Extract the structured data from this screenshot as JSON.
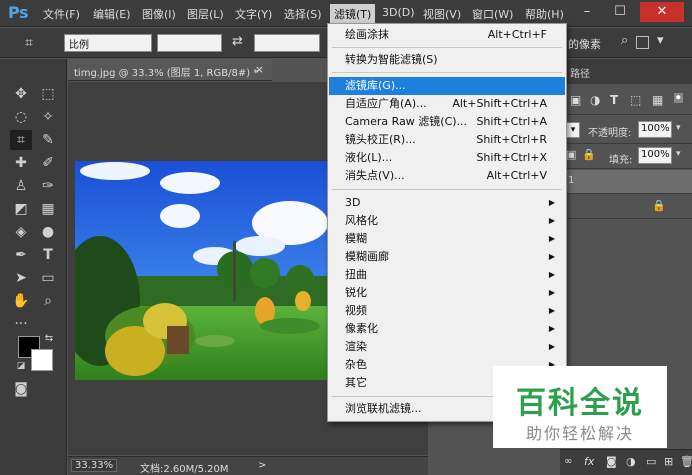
{
  "app": {
    "logo": "Ps"
  },
  "menubar": {
    "items": [
      "文件(F)",
      "编辑(E)",
      "图像(I)",
      "图层(L)",
      "文字(Y)",
      "选择(S)",
      "滤镜(T)",
      "3D(D)",
      "视图(V)",
      "窗口(W)",
      "帮助(H)"
    ],
    "active": "滤镜(T)"
  },
  "window_controls": {
    "minimize": "–",
    "restore": "☐",
    "close": "✕"
  },
  "options_bar": {
    "ratio_select": "比例",
    "swap_icon": "⇄",
    "delete_pixels_label": "的像素"
  },
  "document": {
    "tab_title": "timg.jpg @ 33.3% (图层 1, RGB/8#) *",
    "tab_close": "×",
    "zoom": "33.33%",
    "doc_info": "文档:2.60M/5.20M",
    "status_arrow": ">"
  },
  "right_panel": {
    "tab_label": "路径",
    "opacity_label": "不透明度:",
    "opacity_value": "100%",
    "fill_label": "填充:",
    "fill_value": "100%",
    "layer_number": "1"
  },
  "filter_menu": {
    "items": [
      {
        "label": "绘画涂抹",
        "shortcut": "Alt+Ctrl+F"
      },
      {
        "label": "转换为智能滤镜(S)",
        "shortcut": ""
      },
      {
        "label": "滤镜库(G)...",
        "shortcut": "",
        "highlighted": true
      },
      {
        "label": "自适应广角(A)...",
        "shortcut": "Alt+Shift+Ctrl+A"
      },
      {
        "label": "Camera Raw 滤镜(C)...",
        "shortcut": "Shift+Ctrl+A"
      },
      {
        "label": "镜头校正(R)...",
        "shortcut": "Shift+Ctrl+R"
      },
      {
        "label": "液化(L)...",
        "shortcut": "Shift+Ctrl+X"
      },
      {
        "label": "消失点(V)...",
        "shortcut": "Alt+Ctrl+V"
      },
      {
        "label": "3D",
        "submenu": true
      },
      {
        "label": "风格化",
        "submenu": true
      },
      {
        "label": "模糊",
        "submenu": true
      },
      {
        "label": "模糊画廊",
        "submenu": true
      },
      {
        "label": "扭曲",
        "submenu": true
      },
      {
        "label": "锐化",
        "submenu": true
      },
      {
        "label": "视频",
        "submenu": true
      },
      {
        "label": "像素化",
        "submenu": true
      },
      {
        "label": "渲染",
        "submenu": true
      },
      {
        "label": "杂色",
        "submenu": true
      },
      {
        "label": "其它",
        "submenu": true
      },
      {
        "label": "浏览联机滤镜...",
        "shortcut": ""
      }
    ]
  },
  "watermark": {
    "title": "百科全说",
    "subtitle": "助你轻松解决"
  },
  "colors": {
    "accent_highlight": "#1e80dc",
    "watermark_green": "#2ea04d",
    "ui_dark": "#3c3c3c",
    "canvas_bg": "#535353"
  },
  "icons": {
    "tools": [
      "move-icon",
      "marquee-icon",
      "lasso-icon",
      "magic-wand-icon",
      "crop-icon",
      "eyedropper-icon",
      "healing-brush-icon",
      "brush-icon",
      "stamp-icon",
      "history-brush-icon",
      "eraser-icon",
      "gradient-icon",
      "blur-icon",
      "dodge-icon",
      "pen-icon",
      "type-icon",
      "path-select-icon",
      "rectangle-icon",
      "hand-icon",
      "zoom-icon",
      "more-tools-icon"
    ]
  }
}
